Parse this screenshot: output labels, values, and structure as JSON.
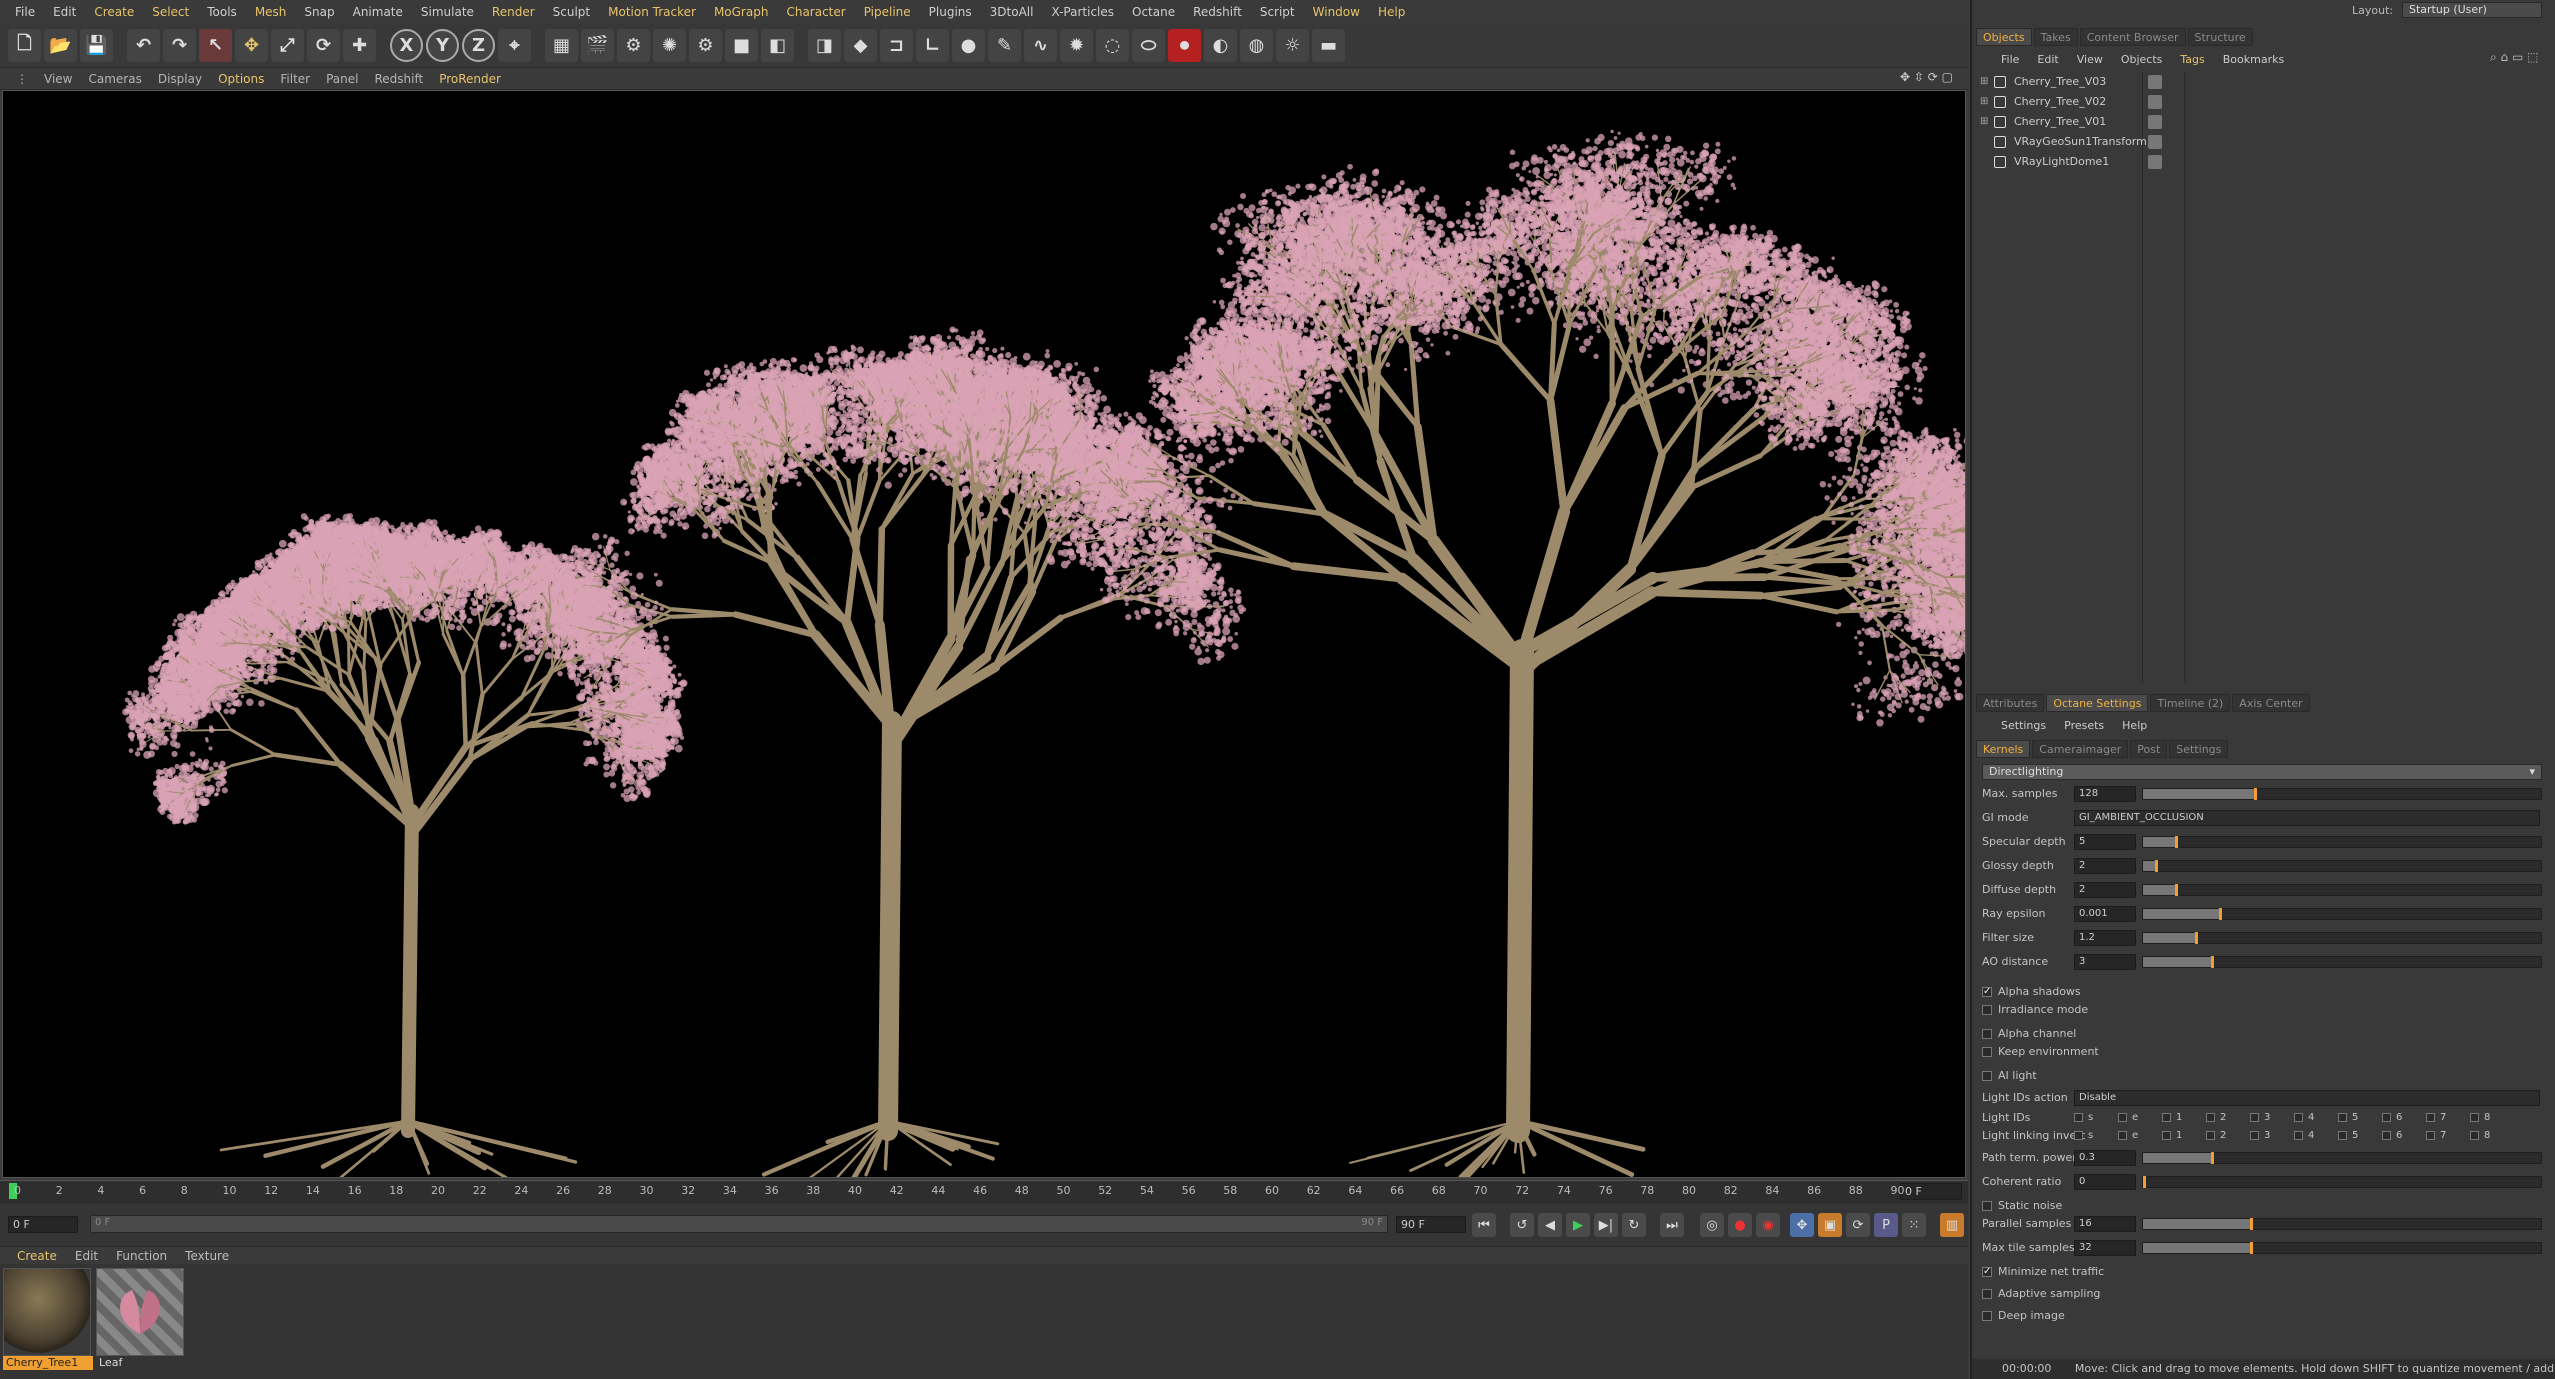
{
  "menubar": {
    "items": [
      "File",
      "Edit",
      "Create",
      "Select",
      "Tools",
      "Mesh",
      "Snap",
      "Animate",
      "Simulate",
      "Render",
      "Sculpt",
      "Motion Tracker",
      "MoGraph",
      "Character",
      "Pipeline",
      "Plugins",
      "3DtoAll",
      "X-Particles",
      "Octane",
      "Redshift",
      "Script",
      "Window",
      "Help"
    ],
    "layout_label": "Layout:",
    "layout_value": "Startup (User)"
  },
  "toolbar": {
    "icons": [
      "new-file",
      "open",
      "save",
      "undo",
      "redo",
      "live-select",
      "move",
      "scale",
      "rotate",
      "create-object",
      "x-axis",
      "y-axis",
      "z-axis",
      "coordinate-system",
      "render-region",
      "render-view",
      "render-settings",
      "octane-live",
      "octane-settings",
      "cube",
      "cube-alt",
      "cube-plain",
      "cube-orange",
      "bend",
      "floor",
      "sphere",
      "pen",
      "spline",
      "generator",
      "deformer",
      "tag",
      "record",
      "octane-env",
      "sky",
      "light",
      "camera"
    ],
    "axis_labels": [
      "X",
      "Y",
      "Z"
    ]
  },
  "viewport_menu": {
    "items": [
      "View",
      "Cameras",
      "Display",
      "Options",
      "Filter",
      "Panel",
      "Redshift",
      "ProRender"
    ]
  },
  "timeline": {
    "ticks": [
      "0",
      "2",
      "4",
      "6",
      "8",
      "10",
      "12",
      "14",
      "16",
      "18",
      "20",
      "22",
      "24",
      "26",
      "28",
      "30",
      "32",
      "34",
      "36",
      "38",
      "40",
      "42",
      "44",
      "46",
      "48",
      "50",
      "52",
      "54",
      "56",
      "58",
      "60",
      "62",
      "64",
      "66",
      "68",
      "70",
      "72",
      "74",
      "76",
      "78",
      "80",
      "82",
      "84",
      "86",
      "88",
      "90"
    ],
    "current_frame": "0 F",
    "start_frame": "0 F",
    "range_start": "0 F",
    "range_end": "90 F",
    "end_frame": "90 F",
    "end_field": "90 F"
  },
  "material_menu": {
    "items": [
      "Create",
      "Edit",
      "Function",
      "Texture"
    ]
  },
  "materials": [
    {
      "name": "Cherry_Tree1",
      "selected": true
    },
    {
      "name": "Leaf",
      "selected": false
    }
  ],
  "object_manager": {
    "tabs": [
      "Objects",
      "Takes",
      "Content Browser",
      "Structure"
    ],
    "active_tab": "Objects",
    "menu": [
      "File",
      "Edit",
      "View",
      "Objects",
      "Tags",
      "Bookmarks"
    ],
    "objects": [
      "Cherry_Tree_V03",
      "Cherry_Tree_V02",
      "Cherry_Tree_V01",
      "VRayGeoSun1Transform",
      "VRayLightDome1"
    ]
  },
  "attr_manager": {
    "tabs": [
      "Attributes",
      "Octane Settings",
      "Timeline (2)",
      "Axis Center"
    ],
    "active_tab": "Octane Settings",
    "menu": [
      "Settings",
      "Presets",
      "Help"
    ],
    "subtabs": [
      "Kernels",
      "Cameraimager",
      "Post",
      "Settings"
    ],
    "active_subtab": "Kernels",
    "kernel": "Directlighting",
    "sliders": [
      {
        "label": "Max. samples",
        "value": "128",
        "fill": 0.28
      },
      {
        "label": "GI mode",
        "value": "GI_AMBIENT_OCCLUSION",
        "dropdown": true
      },
      {
        "label": "Specular depth",
        "value": "5",
        "fill": 0.08
      },
      {
        "label": "Glossy depth",
        "value": "2",
        "fill": 0.03
      },
      {
        "label": "Diffuse depth",
        "value": "2",
        "fill": 0.08
      },
      {
        "label": "Ray epsilon",
        "value": "0.001",
        "fill": 0.19
      },
      {
        "label": "Filter size",
        "value": "1.2",
        "fill": 0.13
      },
      {
        "label": "AO distance",
        "value": "3",
        "fill": 0.17
      }
    ],
    "checks_a": [
      {
        "label": "Alpha shadows",
        "checked": true
      },
      {
        "label": "Irradiance mode",
        "checked": false
      },
      {
        "label": "Alpha channel",
        "checked": false
      },
      {
        "label": "Keep environment",
        "checked": false
      },
      {
        "label": "AI light",
        "checked": false
      }
    ],
    "light_ids_action_label": "Light IDs action",
    "light_ids_action_value": "Disable",
    "light_ids_label": "Light IDs",
    "light_link_label": "Light linking invert",
    "light_id_items": [
      "s",
      "e",
      "1",
      "2",
      "3",
      "4",
      "5",
      "6",
      "7",
      "8"
    ],
    "sliders_b": [
      {
        "label": "Path term. power",
        "value": "0.3",
        "fill": 0.17
      },
      {
        "label": "Coherent ratio",
        "value": "0",
        "fill": 0.0
      }
    ],
    "static_noise": {
      "label": "Static noise",
      "checked": false
    },
    "sliders_c": [
      {
        "label": "Parallel samples",
        "value": "16",
        "fill": 0.27
      },
      {
        "label": "Max tile samples",
        "value": "32",
        "fill": 0.27
      }
    ],
    "checks_b": [
      {
        "label": "Minimize net traffic",
        "checked": true
      },
      {
        "label": "Adaptive sampling",
        "checked": false
      },
      {
        "label": "Deep image",
        "checked": false
      }
    ]
  },
  "status": {
    "time": "00:00:00",
    "message": "Move: Click and drag to move elements. Hold down SHIFT to quantize movement / add to the selection in point mode, CTRL to remove."
  },
  "colors": {
    "accent": "#e8c36a",
    "tab_active": "#f0b040",
    "blossom": "#d9a3b5",
    "bark": "#9c8a6a"
  }
}
